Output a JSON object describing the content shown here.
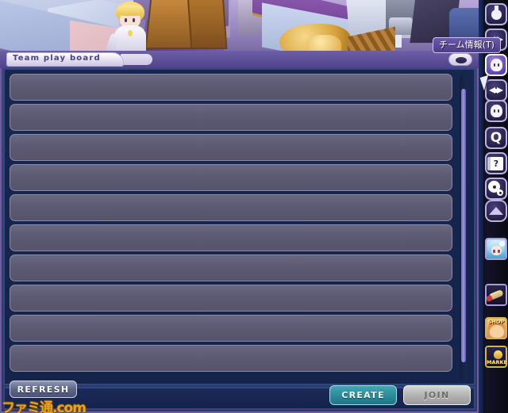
{
  "window": {
    "title": "Team play board",
    "minimize_icon": "minimize-icon"
  },
  "tooltip": {
    "text": "チーム情報(T)"
  },
  "list": {
    "row_count": 10,
    "rows": [
      "",
      "",
      "",
      "",
      "",
      "",
      "",
      "",
      "",
      ""
    ],
    "scrollbar": "vertical-scrollbar"
  },
  "buttons": {
    "refresh": "REFRESH",
    "create": "CREATE",
    "join": "JOIN"
  },
  "watermark": {
    "text": "ファミ通.com"
  },
  "sidebar": {
    "icons": [
      {
        "name": "potion-icon",
        "label": ""
      },
      {
        "name": "mask-bow-icon",
        "label": ""
      },
      {
        "name": "team-info-icon",
        "label": "",
        "active": true
      },
      {
        "name": "bow-icon",
        "label": ""
      },
      {
        "name": "character-face-icon",
        "label": ""
      },
      {
        "name": "quest-q-icon",
        "label": "Q"
      },
      {
        "name": "help-book-icon",
        "label": ""
      },
      {
        "name": "settings-gear-icon",
        "label": ""
      },
      {
        "name": "collapse-up-icon",
        "label": ""
      }
    ],
    "portraits": [
      {
        "name": "avatar-portrait",
        "label": ""
      },
      {
        "name": "inventory-scroll-icon",
        "label": ""
      },
      {
        "name": "shop-button",
        "label": "SHOP"
      },
      {
        "name": "market-button",
        "label": "MARKET"
      }
    ]
  },
  "colors": {
    "panel_border": "#6b5fa0",
    "list_bg": "#16264f",
    "row_fill": "#5d5a73",
    "create_accent": "#2c8d9c",
    "join_disabled": "#b3b3b3",
    "tooltip_bg": "#4b3d86",
    "watermark": "#e8a424"
  }
}
